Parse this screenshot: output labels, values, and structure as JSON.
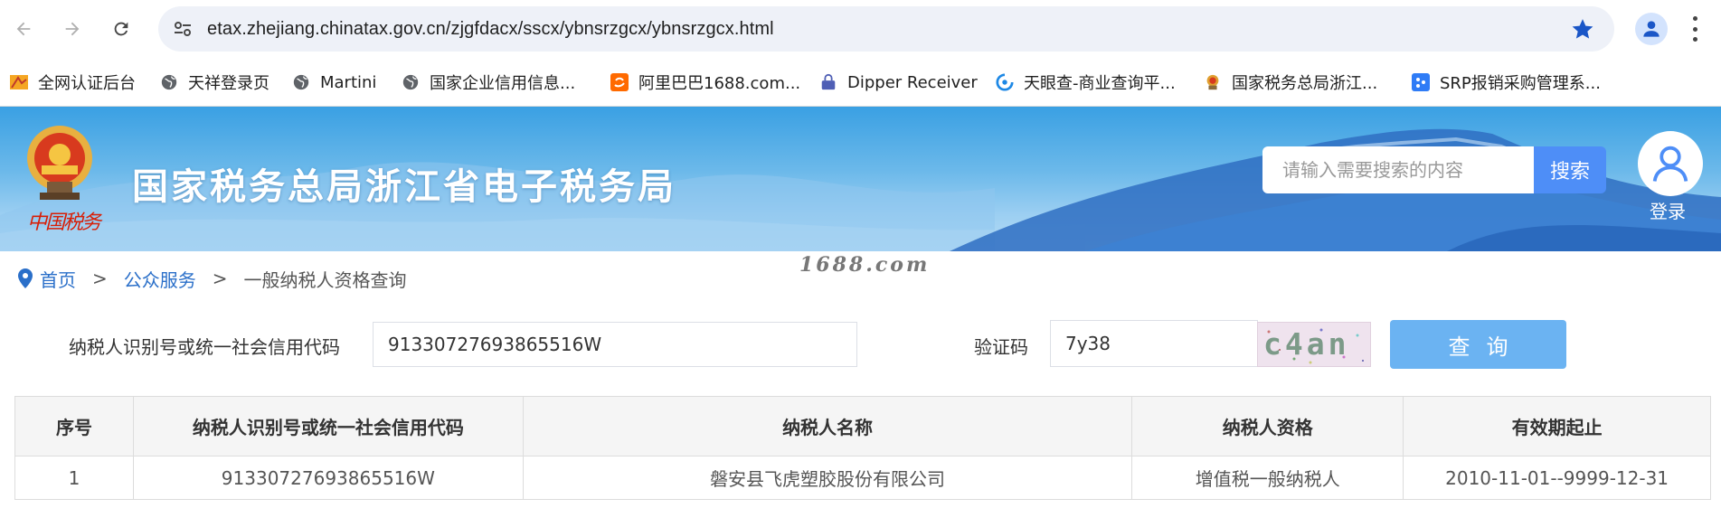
{
  "browser": {
    "url": "etax.zhejiang.chinatax.gov.cn/zjgfdacx/sscx/ybnsrzgcx/ybnsrzgcx.html",
    "bookmarks": [
      {
        "label": "全网认证后台",
        "icon": "folder-icon"
      },
      {
        "label": "天祥登录页",
        "icon": "globe-icon"
      },
      {
        "label": "Martini",
        "icon": "globe-icon"
      },
      {
        "label": "国家企业信用信息...",
        "icon": "globe-icon"
      },
      {
        "label": "阿里巴巴1688.com...",
        "icon": "alibaba-icon"
      },
      {
        "label": "Dipper Receiver",
        "icon": "lock-icon"
      },
      {
        "label": "天眼查-商业查询平...",
        "icon": "tianyancha-icon"
      },
      {
        "label": "国家税务总局浙江...",
        "icon": "tax-emblem-icon"
      },
      {
        "label": "SRP报销采购管理系...",
        "icon": "srp-icon"
      }
    ]
  },
  "header": {
    "seal_text": "中国税务",
    "site_title": "国家税务总局浙江省电子税务局",
    "search_placeholder": "请输入需要搜索的内容",
    "search_button": "搜索",
    "login_label": "登录"
  },
  "breadcrumb": {
    "home": "首页",
    "sep1": ">",
    "public_services": "公众服务",
    "sep2": ">",
    "current": "一般纳税人资格查询"
  },
  "watermark": "1688.com",
  "form": {
    "taxid_label": "纳税人识别号或统一社会信用代码",
    "taxid_value": "91330727693865516W",
    "captcha_label": "验证码",
    "captcha_value": "7y38",
    "captcha_image_text": "c4an",
    "query_button": "查询"
  },
  "table": {
    "headers": [
      "序号",
      "纳税人识别号或统一社会信用代码",
      "纳税人名称",
      "纳税人资格",
      "有效期起止"
    ],
    "rows": [
      [
        "1",
        "91330727693865516W",
        "磐安县飞虎塑胶股份有限公司",
        "增值税一般纳税人",
        "2010-11-01--9999-12-31"
      ]
    ]
  },
  "colors": {
    "accent_blue": "#4e8ef7",
    "query_button": "#6bb3f2",
    "link": "#2a6fc9"
  }
}
